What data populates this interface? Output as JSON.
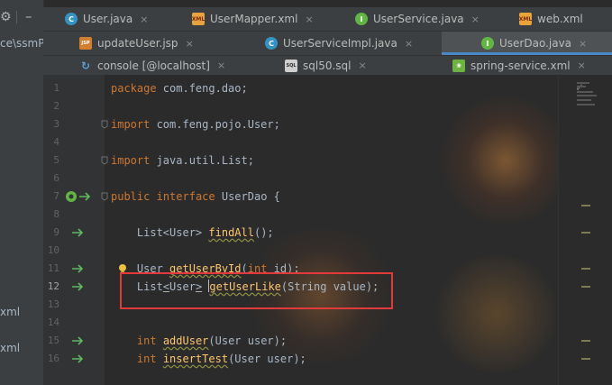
{
  "sidebar": {
    "path_fragment": "ce\\ssmP",
    "frag_xml_1": "xml",
    "frag_xml_2": "xml"
  },
  "tabs": {
    "row1": [
      {
        "label": "User.java",
        "icon": "class-icon"
      },
      {
        "label": "UserMapper.xml",
        "icon": "xml-icon"
      },
      {
        "label": "UserService.java",
        "icon": "interface-icon"
      },
      {
        "label": "web.xml",
        "icon": "xml-icon"
      }
    ],
    "row2": [
      {
        "label": "updateUser.jsp",
        "icon": "jsp-icon"
      },
      {
        "label": "UserServiceImpl.java",
        "icon": "class-icon"
      },
      {
        "label": "UserDao.java",
        "icon": "interface-icon",
        "active": true
      }
    ],
    "row3": [
      {
        "label": "console [@localhost]",
        "icon": "console-icon"
      },
      {
        "label": "sql50.sql",
        "icon": "sql-icon"
      },
      {
        "label": "spring-service.xml",
        "icon": "spring-xml-icon"
      }
    ]
  },
  "icon_text": {
    "class": "C",
    "interface": "I",
    "xml": "XML",
    "jsp": "JSP",
    "sql": "SQL",
    "console": "↻",
    "spring": "❀"
  },
  "close_glyph": "×",
  "editor": {
    "line_numbers": [
      "1",
      "2",
      "3",
      "4",
      "5",
      "6",
      "7",
      "8",
      "9",
      "10",
      "11",
      "12",
      "13",
      "14",
      "15",
      "16"
    ],
    "lines": {
      "l1": {
        "kw": "package",
        "rest": " com.feng.dao;"
      },
      "l3": {
        "kw": "import",
        "rest": " com.feng.pojo.User;"
      },
      "l5": {
        "kw": "import",
        "rest": " java.util.List;"
      },
      "l7": {
        "kw1": "public",
        "kw2": "interface",
        "name": "UserDao",
        "rest": " {"
      },
      "l9": {
        "pre": "List<User> ",
        "fn": "findAll",
        "post": "();"
      },
      "l11": {
        "pre": "User ",
        "fn": "getUserById",
        "post": "(",
        "kw": "int",
        "post2": " id);"
      },
      "l12": {
        "pre1": "List",
        "lt": "<",
        "user": "User",
        "gt": ">",
        "fn": "getUserLike",
        "post": "(String value);"
      },
      "l15": {
        "kw": "int",
        "fn": "addUser",
        "post": "(User user);"
      },
      "l16": {
        "kw": "int",
        "fn": "insertTest",
        "post": "(User user);"
      }
    }
  },
  "colors": {
    "keyword": "#cc7832",
    "method": "#ffc66d",
    "text": "#a9b7c6",
    "highlight_box": "#e23a3a",
    "implemented_arrow": "#5fb85f"
  }
}
